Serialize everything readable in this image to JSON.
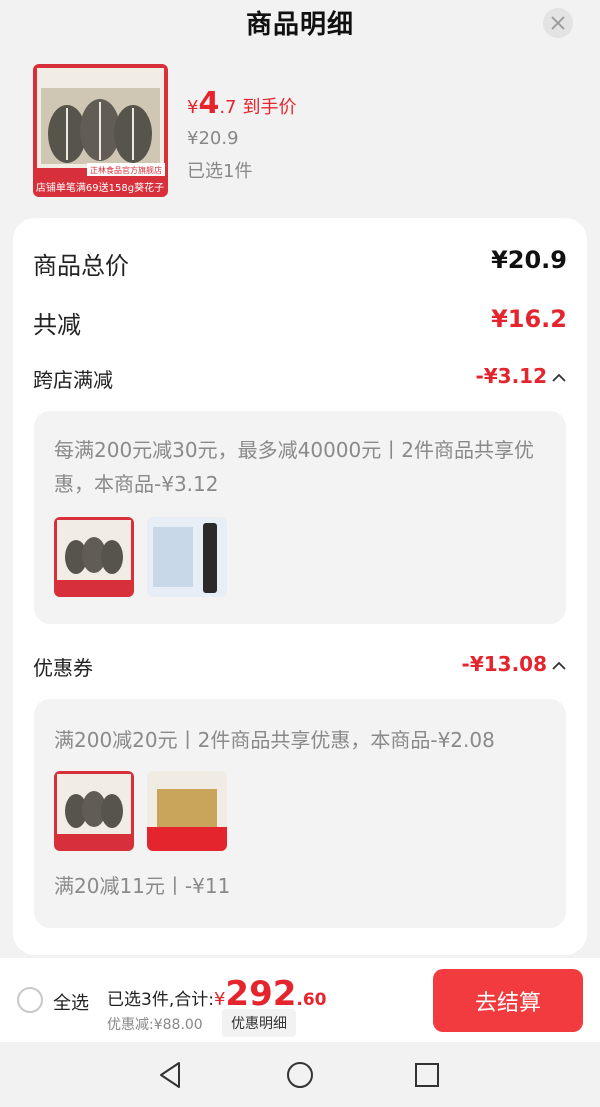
{
  "header": {
    "title": "商品明细"
  },
  "product": {
    "currency": "¥",
    "price_int": "4",
    "price_dec": ".7",
    "price_suffix": "到手价",
    "original_price": "¥20.9",
    "selected": "已选1件",
    "thumb_banner": "店铺单笔满69送158g葵花子",
    "thumb_brand": "正林食品官方旗舰店"
  },
  "summary_rows": {
    "total_label": "商品总价",
    "total_value": "¥20.9",
    "reduce_label": "共减",
    "reduce_value": "¥16.2"
  },
  "cross_store": {
    "label": "跨店满减",
    "value": "-¥3.12",
    "desc": "每满200元减30元，最多减40000元丨2件商品共享优惠，本商品-¥3.12"
  },
  "coupon": {
    "label": "优惠券",
    "value": "-¥13.08",
    "desc": "满200减20元丨2件商品共享优惠，本商品-¥2.08",
    "desc2": "满20减11元丨-¥11"
  },
  "bottom_bar": {
    "select_all": "全选",
    "selected_total_prefix": "已选3件,合计:",
    "currency": "¥",
    "total_int": "292",
    "total_dec": ".60",
    "discount": "优惠减:¥88.00",
    "detail_button": "优惠明细",
    "checkout": "去结算"
  },
  "colors": {
    "accent": "#e5252e",
    "checkout_bg": "#f13b3f"
  },
  "icons": [
    "close-icon",
    "chevron-up-icon",
    "back-icon",
    "home-icon",
    "recents-icon"
  ]
}
